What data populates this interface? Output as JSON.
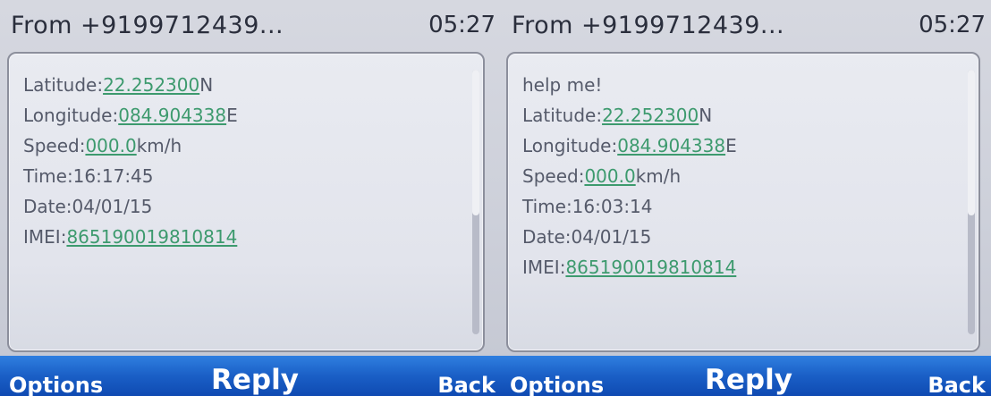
{
  "screens": [
    {
      "header": {
        "sender": "From +9199712439...",
        "time": "05:27"
      },
      "lines": {
        "latitude_label": "Latitude:",
        "latitude_value": "22.252300",
        "latitude_unit": "N",
        "longitude_label": "Longitude:",
        "longitude_value": "084.904338",
        "longitude_unit": "E",
        "speed_label": "Speed:",
        "speed_value": "000.0",
        "speed_unit": "km/h",
        "time": "Time:16:17:45",
        "date": "Date:04/01/15",
        "imei_label": "IMEI:",
        "imei_value": "865190019810814"
      },
      "softkeys": {
        "left": "Options",
        "center": "Reply",
        "right": "Back"
      }
    },
    {
      "header": {
        "sender": "From +9199712439...",
        "time": "05:27"
      },
      "lines": {
        "message": "help me!",
        "latitude_label": "Latitude:",
        "latitude_value": "22.252300",
        "latitude_unit": "N",
        "longitude_label": "Longitude:",
        "longitude_value": "084.904338",
        "longitude_unit": "E",
        "speed_label": "Speed:",
        "speed_value": "000.0",
        "speed_unit": "km/h",
        "time": "Time:16:03:14",
        "date": "Date:04/01/15",
        "imei_label": "IMEI:",
        "imei_value": "865190019810814"
      },
      "softkeys": {
        "left": "Options",
        "center": "Reply",
        "right": "Back"
      }
    }
  ],
  "colors": {
    "link": "#3d9a6e",
    "text": "#555a6a",
    "header_text": "#2a2e3c",
    "softkey_bar": "#1a5fc6"
  }
}
